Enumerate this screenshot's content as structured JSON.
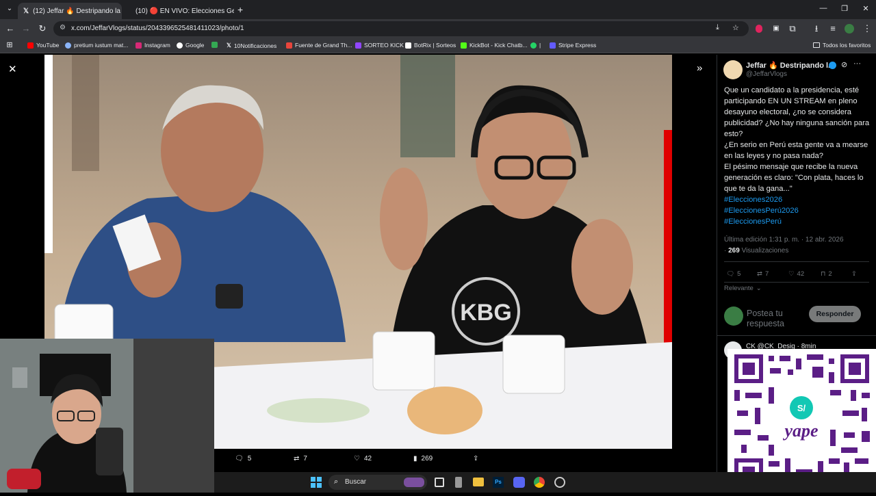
{
  "browser": {
    "tabs": [
      {
        "label": "(12) Jeffar 🔥 Destripando la F..."
      },
      {
        "label": "(10) 🔴 EN VIVO: Elecciones Ge..."
      }
    ],
    "url": "x.com/JeffarVlogs/status/2043396525481411023/photo/1",
    "bookmarks": [
      {
        "label": "YouTube"
      },
      {
        "label": "pretium iustum mat..."
      },
      {
        "label": "Instagram"
      },
      {
        "label": "Google"
      },
      {
        "label": "10Notificaciones"
      },
      {
        "label": "Fuente de Grand Th..."
      },
      {
        "label": "SORTEO KICK"
      },
      {
        "label": "BotRix | Sorteos"
      },
      {
        "label": "KickBot - Kick Chatb..."
      },
      {
        "label": "|"
      },
      {
        "label": "Stripe Express"
      }
    ],
    "all_bookmarks": "Todos los favoritos"
  },
  "tweet": {
    "author_name": "Jeffar 🔥 Destripando l...",
    "handle": "@JeffarVlogs",
    "text_lines": [
      "Que un candidato a la presidencia, esté participando EN UN STREAM en pleno desayuno electoral, ¿no se considera publicidad? ¿No hay ninguna sanción para esto?",
      "¿En serio en Perú esta gente va a mearse en las leyes y no pasa nada?",
      "El pésimo mensaje que recibe la nueva generación es claro: \"Con plata, haces lo que te da la gana...\""
    ],
    "hashtags": [
      "#Elecciones2026",
      "#EleccionesPerú2026",
      "#EleccionesPerú"
    ],
    "edited": "Última edición 1:31 p. m. · 12 abr. 2026",
    "views_count": "269",
    "views_label": "Visualizaciones",
    "stats": {
      "replies": "5",
      "reposts": "7",
      "likes": "42",
      "bookmarks": "2"
    },
    "sort_label": "Relevante",
    "reply_placeholder": "Postea tu respuesta",
    "reply_button": "Responder",
    "next_reply_author": "CK @CK_Desig · 8min"
  },
  "photo_bar": {
    "replies": "5",
    "reposts": "7",
    "likes": "42",
    "views": "269"
  },
  "photo": {
    "shirt_logo": "KBG"
  },
  "overlay": {
    "qr_brand": "yape",
    "qr_symbol": "S/"
  },
  "taskbar": {
    "search_label": "Buscar"
  },
  "colors": {
    "accent": "#1d9bf0",
    "reply_button_bg": "#eff3f4",
    "qr_purple": "#5b1e86"
  }
}
